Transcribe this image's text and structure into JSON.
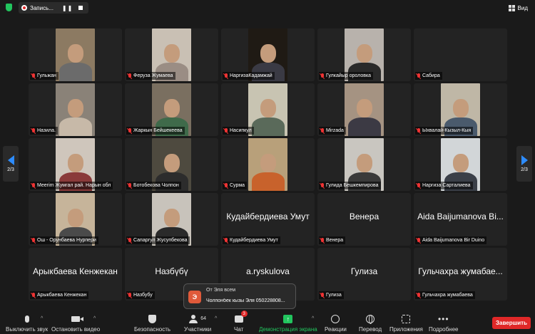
{
  "topbar": {
    "recording_label": "Запись...",
    "view_label": "Вид"
  },
  "pager": {
    "left": "2/3",
    "right": "2/3"
  },
  "tiles": [
    {
      "name": "Гульжан",
      "video": true,
      "bg": "#8c7a62",
      "shirt": "#6b6b6b"
    },
    {
      "name": "Феруза Жумаева",
      "video": true,
      "bg": "#c9c0b4",
      "shirt": "#9a8d84"
    },
    {
      "name": "НаргизаКадамжай",
      "video": true,
      "bg": "#1f1a14",
      "shirt": "#3a3a44"
    },
    {
      "name": "Гулкайыр ороловка",
      "video": true,
      "bg": "#b8b2ac",
      "shirt": "#2a2a2a"
    },
    {
      "name": "Сабира",
      "video": false,
      "big": ""
    },
    {
      "name": "Назила.",
      "video": true,
      "bg": "#8a8278",
      "shirt": "#c7b9a8"
    },
    {
      "name": "Жаркын Бейшекеева",
      "video": true,
      "bg": "#7a6f60",
      "shirt": "#3f6a4a"
    },
    {
      "name": "Насипкул",
      "video": true,
      "bg": "#c8c4b2",
      "shirt": "#5a6a5a"
    },
    {
      "name": "Mirzada",
      "video": true,
      "bg": "#a59382",
      "shirt": "#3c3a44"
    },
    {
      "name": "Ыхвалай-Кызыл-Кыя",
      "video": true,
      "bg": "#bfb7a6",
      "shirt": "#4a5a6c"
    },
    {
      "name": "Meeгim Жумгал рай. Нарын обл",
      "video": true,
      "bg": "#cfc6bc",
      "shirt": "#8a3a3a"
    },
    {
      "name": "Ботобекова Чолпон",
      "video": true,
      "bg": "#4e4a3f",
      "shirt": "#2c2c2c"
    },
    {
      "name": "Сурма",
      "video": true,
      "bg": "#b8a07a",
      "shirt": "#c8622c"
    },
    {
      "name": "Гулида Бешкемпирова",
      "video": true,
      "bg": "#c9c6c0",
      "shirt": "#3a3a3a"
    },
    {
      "name": "Наргиза Сарталиева",
      "video": true,
      "bg": "#d2d6d8",
      "shirt": "#3a3f48"
    },
    {
      "name": "Ош - Орунбаева Нурпери",
      "video": true,
      "bg": "#c6b49a",
      "shirt": "#4a4a4a"
    },
    {
      "name": "Сапаргул Жусупбекова",
      "video": true,
      "bg": "#c8c3bb",
      "shirt": "#2a2a2a"
    },
    {
      "name": "Кудайбердиева Умут",
      "video": false,
      "big": "Кудайбердиева Умут"
    },
    {
      "name": "Венера",
      "video": false,
      "big": "Венера"
    },
    {
      "name": "Aida Baijumanova  Bir Duino",
      "video": false,
      "big": "Aida Baijumanova  Bi..."
    },
    {
      "name": "Арыкбаева Кенжекан",
      "video": false,
      "big": "Арыкбаева Кенжекан"
    },
    {
      "name": "Назбубу",
      "video": false,
      "big": "Назбүбү"
    },
    {
      "name": "",
      "video": false,
      "big": "a.ryskulova"
    },
    {
      "name": "Гулиза",
      "video": false,
      "big": "Гулиза"
    },
    {
      "name": "Гульчахра жумабаева",
      "video": false,
      "big": "Гульчахра жумабае..."
    }
  ],
  "toast": {
    "avatar_letter": "Э",
    "from": "От Эля всем",
    "message": "Чолпонбек кызы Эля 050228808..."
  },
  "toolbar": {
    "mute": "Выключить звук",
    "video": "Остановить видео",
    "security": "Безопасность",
    "participants": "Участники",
    "participants_count": "64",
    "chat": "Чат",
    "chat_badge": "3",
    "share": "Демонстрация экрана",
    "reactions": "Реакции",
    "translate": "Перевод",
    "apps": "Приложения",
    "more": "Подробнее",
    "end": "Завершить"
  },
  "colors": {
    "accent": "#2d8cff",
    "share_green": "#22c55e",
    "end_red": "#e02828"
  }
}
